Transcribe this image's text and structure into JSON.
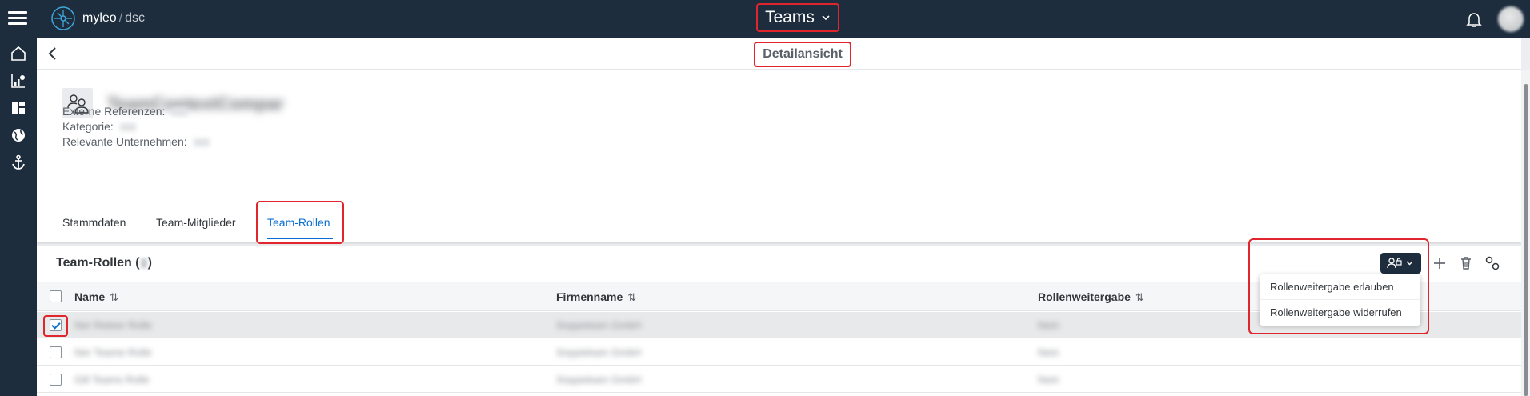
{
  "app": {
    "logo_name": "myleo",
    "logo_slash": "/",
    "logo_product": "dsc",
    "title": "Teams"
  },
  "sidenav": {
    "items": [
      {
        "icon": "home-icon"
      },
      {
        "icon": "chart-icon"
      },
      {
        "icon": "dashboard-icon"
      },
      {
        "icon": "globe-icon"
      },
      {
        "icon": "anchor-icon"
      }
    ]
  },
  "detail": {
    "title": "Detailansicht"
  },
  "object": {
    "name": "TeamContextCompar",
    "attributes": [
      {
        "label": "Externe Referenzen:"
      },
      {
        "label": "Kategorie:"
      },
      {
        "label": "Relevante Unternehmen:"
      }
    ]
  },
  "tabs": [
    {
      "label": "Stammdaten"
    },
    {
      "label": "Team-Mitglieder"
    },
    {
      "label": "Team-Rollen"
    }
  ],
  "table": {
    "title_prefix": "Team-Rollen (",
    "title_suffix": ")",
    "columns": [
      {
        "label": "Name"
      },
      {
        "label": "Firmenname"
      },
      {
        "label": "Rollenweitergabe"
      }
    ],
    "rows": [
      {
        "selected": true,
        "name": "Ner Reteer Rolle",
        "company": "Snppiekam GmbH",
        "sharing": "Nein"
      },
      {
        "selected": false,
        "name": "Ner Teame Rolle",
        "company": "Snppiekam GmbH",
        "sharing": "Nein"
      },
      {
        "selected": false,
        "name": "Gill Teams Rolle",
        "company": "Snppiekam GmbH",
        "sharing": "Nein"
      }
    ]
  },
  "menu": {
    "items": [
      {
        "label": "Rollenweitergabe erlauben"
      },
      {
        "label": "Rollenweitergabe widerrufen"
      }
    ]
  },
  "colors": {
    "shell": "#1d2d3e",
    "accent": "#0a6ed1",
    "highlight": "#e0262c"
  }
}
